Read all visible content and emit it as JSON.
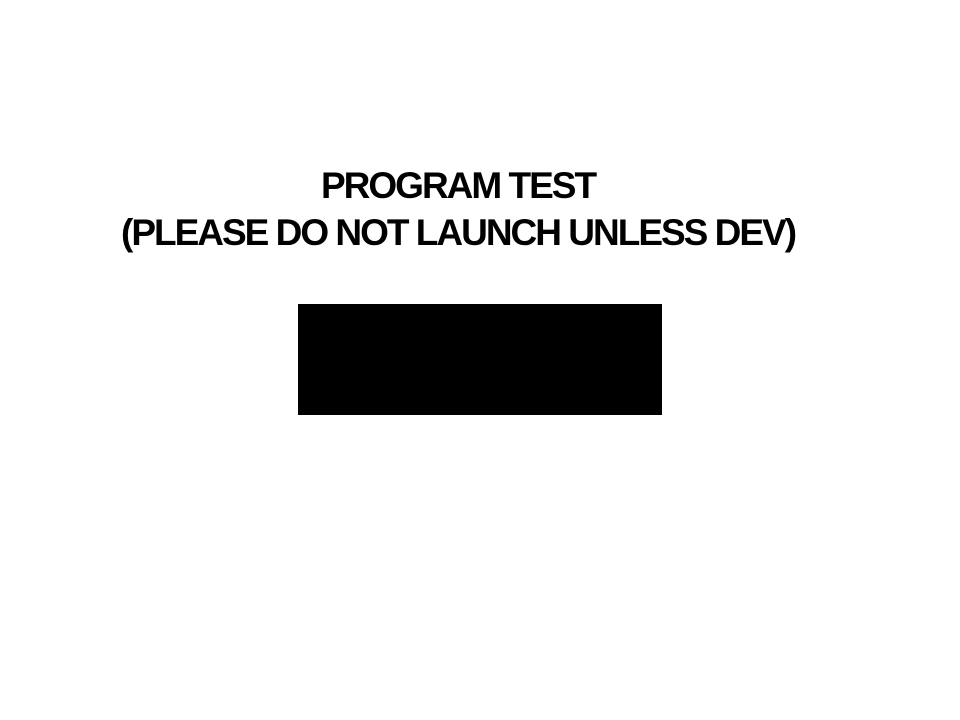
{
  "title": {
    "line1": "PROGRAM TEST",
    "line2": "(PLEASE DO NOT LAUNCH UNLESS DEV)"
  },
  "colors": {
    "background": "#ffffff",
    "text": "#000000",
    "box": "#000000"
  }
}
